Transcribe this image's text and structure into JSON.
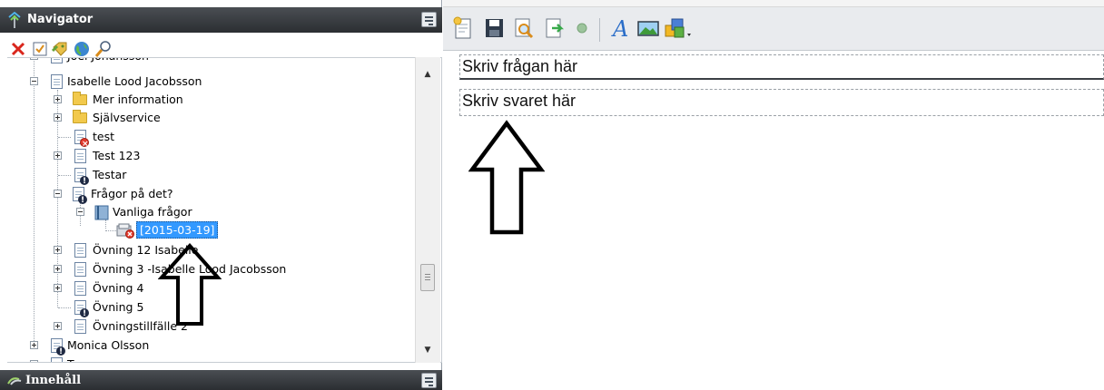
{
  "navigator": {
    "title": "Navigator",
    "toolbar": [
      {
        "icon": "delete-icon"
      },
      {
        "icon": "checklist-icon"
      },
      {
        "icon": "tags-icon"
      },
      {
        "icon": "globe-icon"
      },
      {
        "icon": "search-icon"
      }
    ]
  },
  "tree": {
    "items": [
      {
        "label": "Joel Johansson",
        "icon": "document-icon"
      },
      {
        "label": "Isabelle Lood Jacobsson",
        "icon": "document-icon",
        "expanded": true
      },
      {
        "label": "Mer information",
        "icon": "folder-icon"
      },
      {
        "label": "Självservice",
        "icon": "folder-icon"
      },
      {
        "label": "test",
        "icon": "document-error-icon"
      },
      {
        "label": "Test 123",
        "icon": "document-icon"
      },
      {
        "label": "Testar",
        "icon": "document-info-icon"
      },
      {
        "label": "Frågor på det?",
        "icon": "document-info-icon",
        "expanded": true
      },
      {
        "label": "Vanliga frågor",
        "icon": "faq-book-icon",
        "expanded": true
      },
      {
        "label": "[2015-03-19]",
        "icon": "faq-item-error-icon",
        "selected": true
      },
      {
        "label": "Övning 12 Isabelle",
        "icon": "document-icon"
      },
      {
        "label": "Övning 3 -Isabelle Lood Jacobsson",
        "icon": "document-icon"
      },
      {
        "label": "Övning 4",
        "icon": "document-icon"
      },
      {
        "label": "Övning 5",
        "icon": "document-info-icon"
      },
      {
        "label": "Övningstillfälle 2",
        "icon": "document-icon"
      },
      {
        "label": "Monica Olsson",
        "icon": "document-info-icon"
      },
      {
        "label": "Tess",
        "icon": "document-icon"
      }
    ]
  },
  "content_panel": {
    "title": "Innehåll"
  },
  "editor": {
    "toolbar": [
      {
        "icon": "new-document-icon"
      },
      {
        "icon": "save-icon"
      },
      {
        "icon": "preview-icon"
      },
      {
        "icon": "export-icon"
      },
      {
        "icon": "status-dot-icon"
      },
      {
        "icon": "font-icon"
      },
      {
        "icon": "image-icon"
      },
      {
        "icon": "shapes-icon"
      }
    ],
    "question_placeholder": "Skriv frågan här",
    "answer_placeholder": "Skriv svaret här"
  },
  "colors": {
    "header_dark": "#2b2e32",
    "selection": "#3399ff",
    "toolbar_bg": "#e9ebee"
  }
}
